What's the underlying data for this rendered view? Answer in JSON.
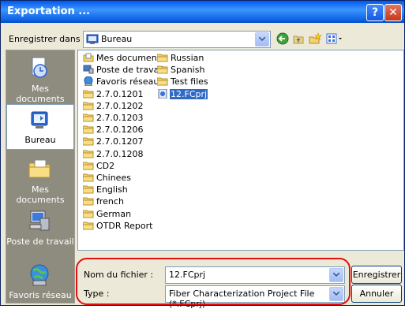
{
  "window": {
    "title": "Exportation ...",
    "help_glyph": "?",
    "close_glyph": "✕"
  },
  "location": {
    "label": "Enregistrer dans :",
    "value": "Bureau"
  },
  "places": [
    {
      "label": "Mes documents récents",
      "icon": "recent-documents-icon"
    },
    {
      "label": "Bureau",
      "icon": "desktop-icon",
      "selected": true
    },
    {
      "label": "Mes documents",
      "icon": "my-documents-icon"
    },
    {
      "label": "Poste de travail",
      "icon": "my-computer-icon"
    },
    {
      "label": "Favoris réseau",
      "icon": "network-places-icon"
    }
  ],
  "files_col1": [
    "Mes documents",
    "Poste de travail",
    "Favoris réseau",
    "2.7.0.1201",
    "2.7.0.1202",
    "2.7.0.1203",
    "2.7.0.1206",
    "2.7.0.1207",
    "2.7.0.1208",
    "CD2",
    "Chinees",
    "English",
    "french",
    "German",
    "OTDR Report"
  ],
  "files_col2": [
    "Russian",
    "Spanish",
    "Test files",
    "12.FCprj"
  ],
  "filename": {
    "label": "Nom du fichier :",
    "value": "12.FCprj"
  },
  "filetype": {
    "label": "Type :",
    "value": "Fiber Characterization Project File (*.FCprj)"
  },
  "buttons": {
    "save": "Enregistrer",
    "cancel": "Annuler"
  },
  "colors": {
    "title_bar": "#0058ee",
    "selection": "#316ac5",
    "highlight_oval": "#e01010"
  }
}
